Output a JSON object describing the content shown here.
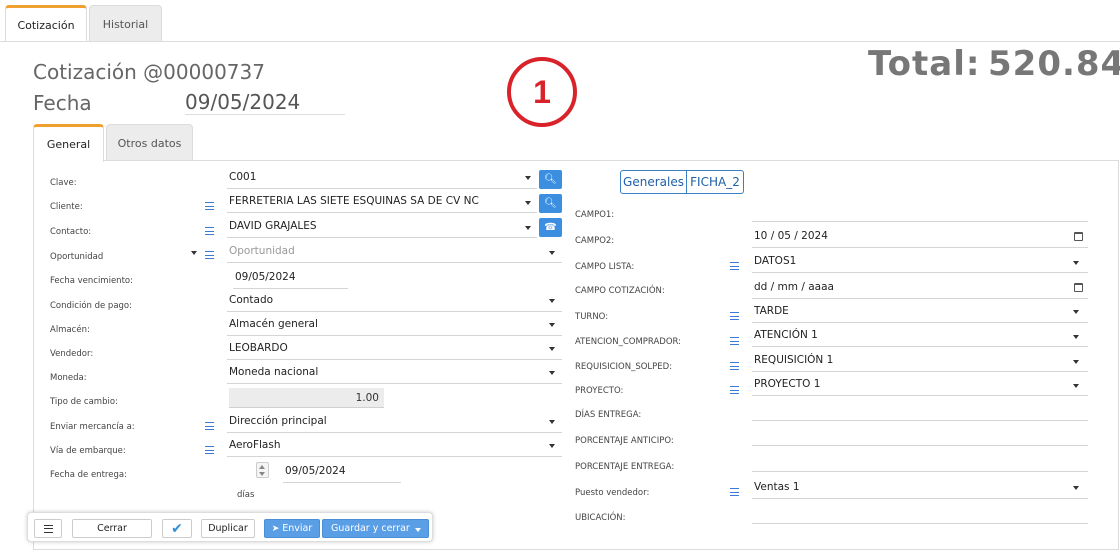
{
  "tabs": {
    "quote": "Cotización",
    "history": "Historial"
  },
  "header": {
    "quote_label": "Cotización @00000737",
    "date_label": "Fecha",
    "date_value": "09/05/2024",
    "total_label": "Total:",
    "total_value": "520.84",
    "step_badge": "1"
  },
  "subtabs": {
    "general": "General",
    "other": "Otros datos"
  },
  "left": {
    "labels": {
      "clave": "Clave:",
      "cliente": "Cliente:",
      "contacto": "Contacto:",
      "oportunidad": "Oportunidad",
      "fecha_venc": "Fecha vencimiento:",
      "condicion": "Condición de pago:",
      "almacen": "Almacén:",
      "vendedor": "Vendedor:",
      "moneda": "Moneda:",
      "tipo_cambio": "Tipo de cambio:",
      "enviar": "Enviar mercancía a:",
      "via": "Vía de embarque:",
      "fecha_entrega": "Fecha de entrega:"
    },
    "values": {
      "clave": "C001",
      "cliente": "FERRETERIA LAS SIETE ESQUINAS SA DE CV NC",
      "contacto": "DAVID GRAJALES",
      "oportunidad_placeholder": "Oportunidad",
      "fecha_venc": "09/05/2024",
      "condicion": "Contado",
      "almacen": "Almacén general",
      "vendedor": "LEOBARDO",
      "moneda": "Moneda nacional",
      "tipo_cambio": "1.00",
      "enviar": "Dirección principal",
      "via": "AeroFlash",
      "fecha_entrega": "09/05/2024",
      "dias": "días"
    }
  },
  "right": {
    "segments": {
      "generales": "Generales",
      "ficha": "FICHA_2"
    },
    "labels": {
      "campo1": "CAMPO1:",
      "campo2": "CAMPO2:",
      "campo_lista": "CAMPO LISTA:",
      "campo_cot": "CAMPO COTIZACIÓN:",
      "turno": "TURNO:",
      "atencion": "ATENCION_COMPRADOR:",
      "requisicion": "REQUISICION_SOLPED:",
      "proyecto": "PROYECTO:",
      "dias_entrega": "DÍAS ENTREGA:",
      "porc_anticipo": "PORCENTAJE ANTICIPO:",
      "porc_entrega": "PORCENTAJE ENTREGA:",
      "puesto": "Puesto vendedor:",
      "ubicacion": "UBICACIÓN:"
    },
    "values": {
      "campo2": "10 / 05 / 2024",
      "campo_lista": "DATOS1",
      "campo_cot": "dd / mm / aaaa",
      "turno": "TARDE",
      "atencion": "ATENCIÓN 1",
      "requisicion": "REQUISICIÓN 1",
      "proyecto": "PROYECTO 1",
      "puesto": "Ventas 1"
    }
  },
  "toolbar": {
    "cerrar": "Cerrar",
    "duplicar": "Duplicar",
    "enviar": "Enviar",
    "guardar_cerrar": "Guardar y cerrar"
  },
  "colors": {
    "accent": "#3b8ee0",
    "tab_active": "#f0a030",
    "badge": "#d9232a"
  }
}
